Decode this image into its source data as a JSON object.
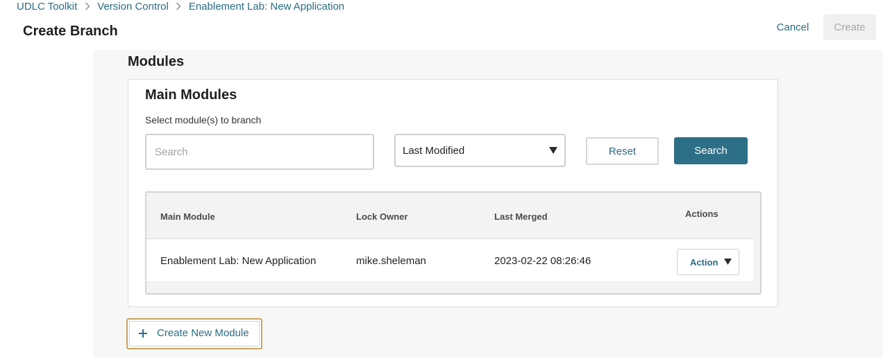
{
  "breadcrumb": [
    {
      "label": "UDLC Toolkit"
    },
    {
      "label": "Version Control"
    },
    {
      "label": "Enablement Lab: New Application"
    }
  ],
  "page_title": "Create Branch",
  "header_actions": {
    "cancel_label": "Cancel",
    "create_label": "Create",
    "create_disabled": true
  },
  "section_title": "Modules",
  "card": {
    "title": "Main Modules",
    "subtitle": "Select module(s) to branch",
    "search": {
      "placeholder": "Search",
      "value": ""
    },
    "sort": {
      "selected": "Last Modified",
      "icon": "triangle-down-icon"
    },
    "reset_label": "Reset",
    "search_label": "Search"
  },
  "table": {
    "headers": {
      "main_module": "Main Module",
      "lock_owner": "Lock Owner",
      "last_merged": "Last Merged",
      "actions": "Actions"
    },
    "rows": [
      {
        "main_module": "Enablement Lab: New Application",
        "lock_owner": "mike.sheleman",
        "last_merged": "2023-02-22 08:26:46",
        "action_label": "Action"
      }
    ]
  },
  "create_new_module_label": "Create New Module",
  "colors": {
    "accent": "#2a6c84",
    "primary_button": "#2d6f86",
    "focus_outline": "#c8a35a",
    "content_bg": "#f7f7f7"
  }
}
